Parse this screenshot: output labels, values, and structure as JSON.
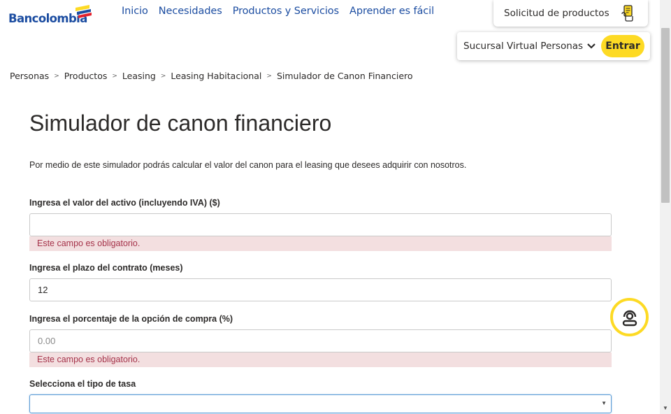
{
  "brand": {
    "name": "Bancolombia",
    "color": "#1c4da1",
    "accent": "#fdda24"
  },
  "nav": {
    "items": [
      "Inicio",
      "Necesidades",
      "Productos y Servicios",
      "Aprender es fácil"
    ]
  },
  "solicitud": {
    "label": "Solicitud de productos",
    "icon": "hand-form-icon"
  },
  "sucursal": {
    "label": "Sucursal Virtual Personas",
    "icon": "chevron-down-icon",
    "button": "Entrar"
  },
  "breadcrumb": [
    "Personas",
    "Productos",
    "Leasing",
    "Leasing Habitacional",
    "Simulador de Canon Financiero"
  ],
  "page": {
    "title": "Simulador de canon financiero",
    "intro": "Por medio de este simulador podrás calcular el valor del canon para el leasing que desees adquirir con nosotros."
  },
  "form": {
    "activo": {
      "label": "Ingresa el valor del activo (incluyendo IVA) ($)",
      "value": "",
      "error": "Este campo es obligatorio."
    },
    "plazo": {
      "label": "Ingresa el plazo del contrato (meses)",
      "value": "12"
    },
    "opcion": {
      "label": "Ingresa el porcentaje de la opción de compra (%)",
      "placeholder": "0.00",
      "error": "Este campo es obligatorio."
    },
    "tasa": {
      "label": "Selecciona el tipo de tasa",
      "value": ""
    }
  },
  "chat": {
    "icon": "chat-agent-icon"
  },
  "error_color": "#a5334a"
}
